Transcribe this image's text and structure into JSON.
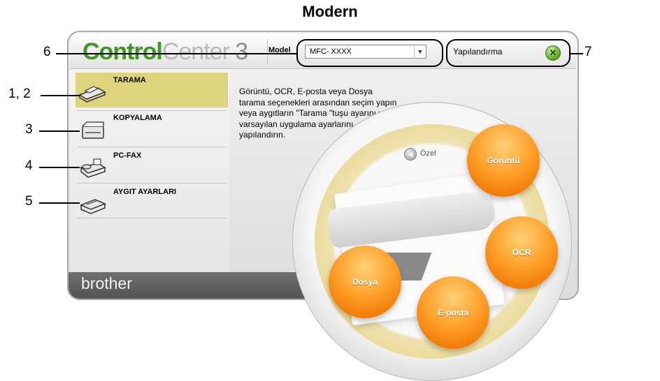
{
  "figure_title": "Modern",
  "app": {
    "logo_part1": "Control",
    "logo_part2": "Center",
    "logo_part3": "3",
    "model_label": "Model",
    "model_value": "MFC- XXXX",
    "config_label": "Yapılandırma",
    "brand": "brother"
  },
  "sidebar": {
    "items": [
      {
        "label": "TARAMA",
        "icon": "scanner-icon",
        "active": true
      },
      {
        "label": "KOPYALAMA",
        "icon": "copier-icon",
        "active": false
      },
      {
        "label": "PC-FAX",
        "icon": "fax-icon",
        "active": false
      },
      {
        "label": "AYGIT AYARLARI",
        "icon": "device-settings-icon",
        "active": false
      }
    ]
  },
  "main": {
    "description": "Görüntü, OCR, E-posta veya Dosya tarama seçenekleri arasından seçim yapın veya aygıtların \"Tarama \"tuşu ayarını veya varsayılan uygulama ayarlarını yapılandırın.",
    "ozel_label": "Özel",
    "buttons": {
      "goruntu": "Görüntü",
      "ocr": "OCR",
      "eposta": "E-posta",
      "dosya": "Dosya"
    }
  },
  "callouts": {
    "c12": "1, 2",
    "c3": "3",
    "c4": "4",
    "c5": "5",
    "c6": "6",
    "c7": "7"
  },
  "colors": {
    "accent_green": "#3c9a1f",
    "selected_item": "#ddd47d",
    "orb_orange": "#f38d14"
  }
}
